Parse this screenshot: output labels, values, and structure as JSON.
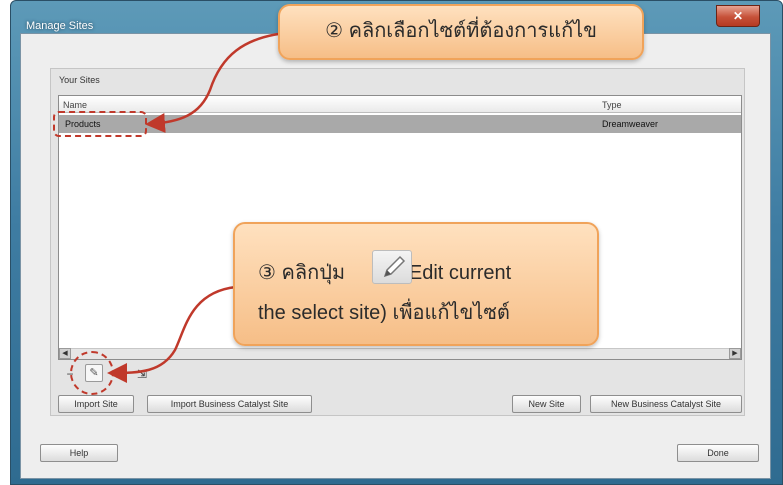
{
  "window": {
    "title": "Manage Sites",
    "close_label": "✕"
  },
  "sites": {
    "group_label": "Your Sites",
    "columns": [
      "Name",
      "Type"
    ],
    "rows": [
      {
        "name": "Products",
        "type": "Dreamweaver"
      }
    ]
  },
  "toolbar": {
    "remove_icon": "−",
    "edit_icon": "✎",
    "duplicate_icon": "⧉",
    "export_icon": "⇲"
  },
  "scrollbar": {
    "left_arrow": "◀",
    "right_arrow": "▶"
  },
  "buttons": {
    "import_site": "Import Site",
    "import_bc_site": "Import Business Catalyst Site",
    "new_site": "New Site",
    "new_bc_site": "New Business Catalyst Site",
    "help": "Help",
    "done": "Done"
  },
  "callouts": {
    "step2": "② คลิกเลือกไซต์ที่ต้องการแก้ไข",
    "step3_line1_prefix": "③ คลิกปุ่ม",
    "step3_line1_suffix": "(Edit current",
    "step3_line2": "the select site) เพื่อแก้ไขไซต์"
  },
  "colors": {
    "annotation_red": "#c0392b",
    "callout_fill": "#f6be87",
    "selected_row": "#a9a9a9"
  }
}
